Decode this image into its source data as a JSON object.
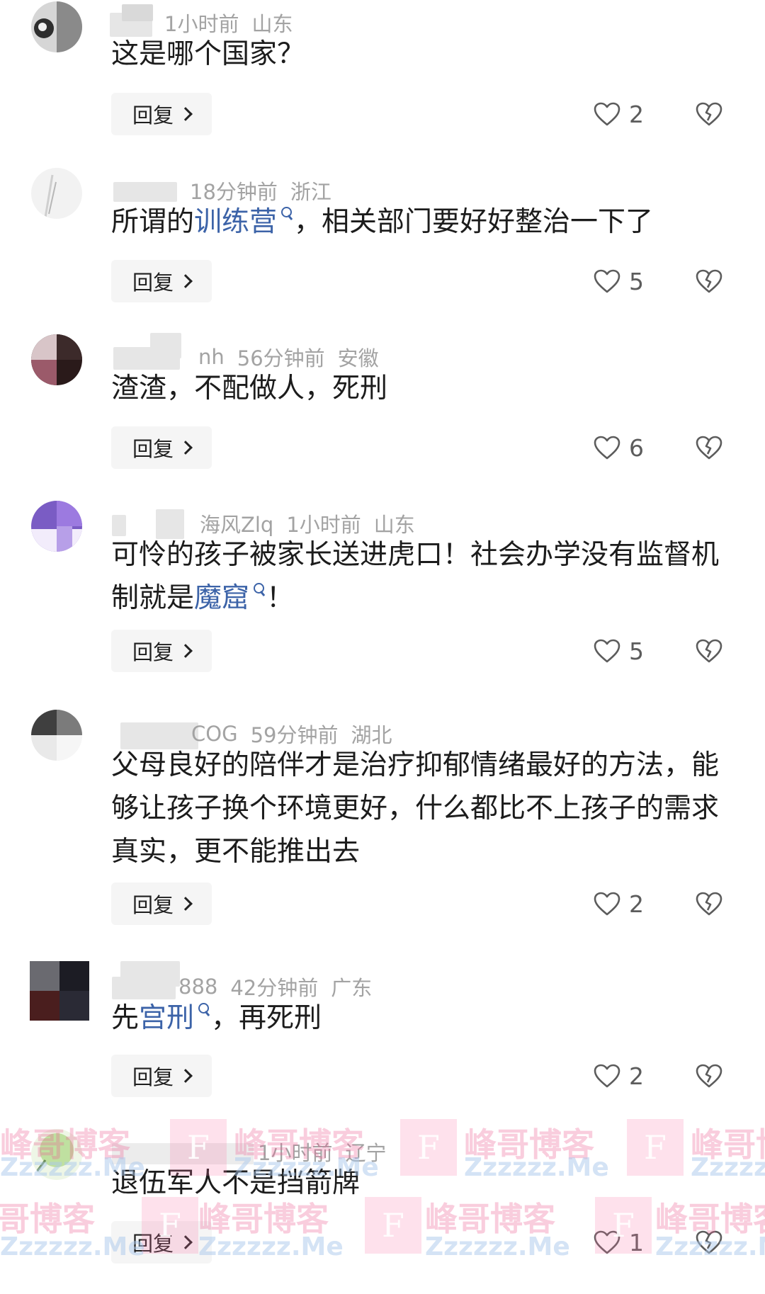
{
  "colors": {
    "text": "#1c1c1c",
    "meta": "#a3a3a3",
    "link": "#3c63a8",
    "reply_bg": "#f5f5f5"
  },
  "reply_label": "回复",
  "comments": [
    {
      "user_suffix": "",
      "user_prefix": "",
      "time": "1小时前",
      "location": "山东",
      "text": "这是哪个国家？",
      "likes": "2"
    },
    {
      "user_suffix": "",
      "user_prefix": "",
      "time": "18分钟前",
      "location": "浙江",
      "text_before": "所谓的",
      "link": "训练营",
      "text_after": "，相关部门要好好整治一下了",
      "likes": "5"
    },
    {
      "user_suffix": "nh",
      "user_prefix": "",
      "time": "56分钟前",
      "location": "安徽",
      "text": "渣渣，不配做人，死刑",
      "likes": "6"
    },
    {
      "user_suffix": "海风Zlq",
      "user_prefix": "",
      "time": "1小时前",
      "location": "山东",
      "text_before": "可怜的孩子被家长送进虎口！社会办学没有监督机制就是",
      "link": "魔窟",
      "text_after": "！",
      "likes": "5"
    },
    {
      "user_suffix": "COG",
      "user_prefix": "",
      "time": "59分钟前",
      "location": "湖北",
      "text": "父母良好的陪伴才是治疗抑郁情绪最好的方法，能够让孩子换个环境更好，什么都比不上孩子的需求真实，更不能推出去",
      "likes": "2"
    },
    {
      "user_suffix": "888",
      "user_prefix": "",
      "time": "42分钟前",
      "location": "广东",
      "text_before": "先",
      "link": "宫刑",
      "text_after": "，再死刑",
      "likes": "2"
    },
    {
      "user_suffix": "",
      "user_prefix": "",
      "time": "1小时前",
      "location": "辽宁",
      "text": "退伍军人不是挡箭牌",
      "likes": "1"
    }
  ],
  "watermark": {
    "brand": "峰哥博客",
    "site": "Zzzzzz.Me",
    "logo_letter": "F"
  }
}
